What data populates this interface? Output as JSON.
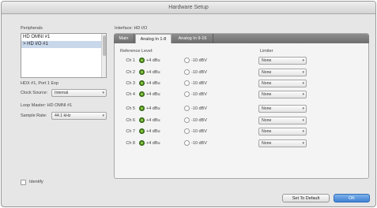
{
  "window": {
    "title": "Hardware Setup"
  },
  "peripherals": {
    "label": "Peripherals",
    "items": [
      "HD OMNI #1",
      "> HD I/O #1"
    ],
    "selected_index": 1
  },
  "device_info": "HDX #1, Port 1 Exp",
  "clock_source": {
    "label": "Clock Source:",
    "value": "Internal"
  },
  "loop_master": "Loop Master: HD OMNI #1",
  "sample_rate": {
    "label": "Sample Rate:",
    "value": "44.1 kHz"
  },
  "identify": {
    "label": "Identify",
    "checked": false
  },
  "interface": {
    "label": "Interface: HD I/O"
  },
  "tabs": [
    "Main",
    "Analog In 1-8",
    "Analog In 9-16"
  ],
  "active_tab": 1,
  "reference_level": {
    "label": "Reference Level:",
    "option_a": "+4 dBu",
    "option_b": "-10 dBV",
    "channels": [
      {
        "name": "Ch 1",
        "selected": "+4 dBu",
        "limiter": "None"
      },
      {
        "name": "Ch 2",
        "selected": "+4 dBu",
        "limiter": "None"
      },
      {
        "name": "Ch 3",
        "selected": "+4 dBu",
        "limiter": "None"
      },
      {
        "name": "Ch 4",
        "selected": "+4 dBu",
        "limiter": "None"
      },
      {
        "name": "Ch 5",
        "selected": "+4 dBu",
        "limiter": "None"
      },
      {
        "name": "Ch 6",
        "selected": "+4 dBu",
        "limiter": "None"
      },
      {
        "name": "Ch 7",
        "selected": "+4 dBu",
        "limiter": "None"
      },
      {
        "name": "Ch 8",
        "selected": "+4 dBu",
        "limiter": "None"
      }
    ]
  },
  "limiter": {
    "label": "Limiter"
  },
  "buttons": {
    "set_default": "Set To Default",
    "ok": "OK"
  },
  "colors": {
    "ok_blue": "#3f82d4",
    "radio_green": "#4a8d1e"
  }
}
